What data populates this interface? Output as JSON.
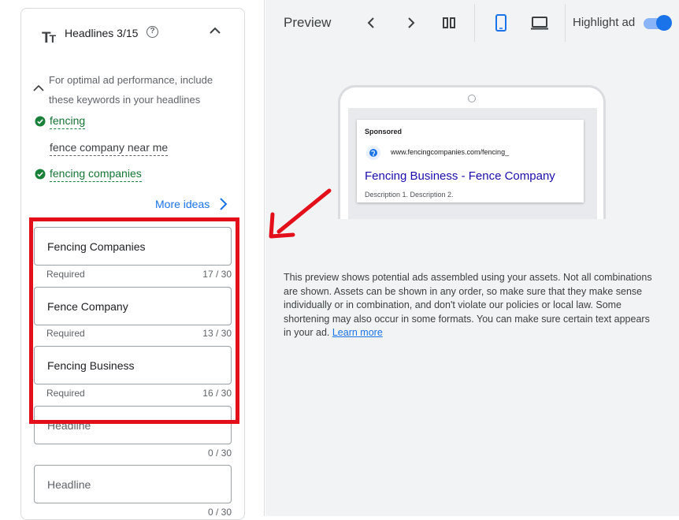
{
  "headlines_panel": {
    "title": "Headlines 3/15",
    "help_icon": "help-circle-icon",
    "hint": "For optimal ad performance, include these keywords in your headlines",
    "keywords": [
      {
        "text": "fencing",
        "used": true
      },
      {
        "text": "fence company near me",
        "used": false
      },
      {
        "text": "fencing companies",
        "used": true
      }
    ],
    "more_ideas": "More ideas",
    "fields": [
      {
        "value": "Fencing Companies",
        "required": "Required",
        "count": "17 / 30"
      },
      {
        "value": "Fence Company",
        "required": "Required",
        "count": "13 / 30"
      },
      {
        "value": "Fencing Business",
        "required": "Required",
        "count": "16 / 30"
      },
      {
        "placeholder": "Headline",
        "count": "0 / 30"
      },
      {
        "placeholder": "Headline",
        "count": "0 / 30"
      }
    ]
  },
  "preview": {
    "label": "Preview",
    "highlight_label": "Highlight ad",
    "highlight_on": true,
    "ad": {
      "sponsored": "Sponsored",
      "url": "www.fencingcompanies.com/fencing_",
      "headline": "Fencing Business - Fence Company",
      "description": "Description 1. Description 2."
    },
    "info_text": "This preview shows potential ads assembled using your assets. Not all combinations are shown. Assets can be shown in any order, so make sure that they make sense individually or in combination, and don't violate our policies or local law. Some shortening may also occur in some formats. You can make sure certain text appears in your ad.",
    "learn_more": "Learn more"
  },
  "colors": {
    "accent": "#1a73e8",
    "highlight_box": "#e3101b",
    "keyword_used": "#137333"
  }
}
